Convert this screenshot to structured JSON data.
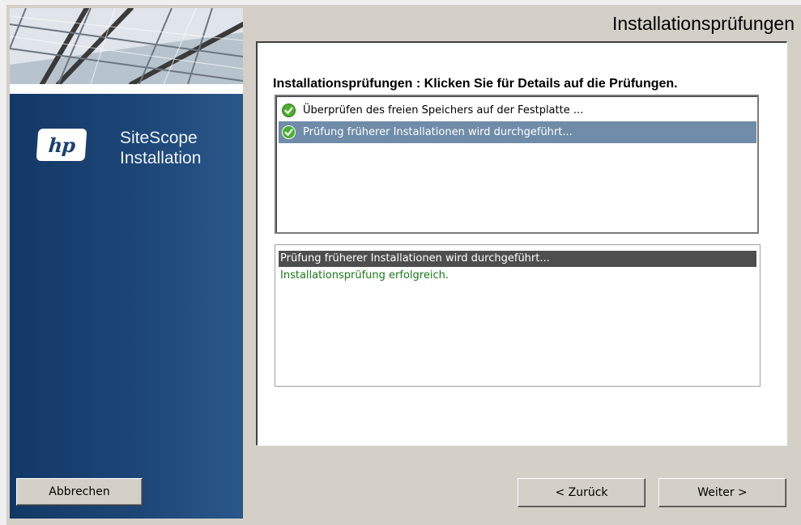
{
  "sidebar": {
    "brand_logo_text": "hp",
    "product_name_line1": "SiteScope",
    "product_name_line2": "Installation",
    "cancel_label": "Abbrechen"
  },
  "header": {
    "title": "Installationsprüfungen"
  },
  "checks": {
    "heading": "Installationsprüfungen : Klicken Sie für Details auf die Prüfungen.",
    "items": [
      {
        "label": "Überprüfen des freien Speichers auf der Festplatte ...",
        "status": "success",
        "selected": false
      },
      {
        "label": "Prüfung früherer Installationen wird durchgeführt...",
        "status": "success",
        "selected": true
      }
    ]
  },
  "details": {
    "title_line": "Prüfung früherer Installationen wird durchgeführt...",
    "result_line": "Installationsprüfung erfolgreich."
  },
  "navigation": {
    "back_label": "< Zurück",
    "next_label": "Weiter >"
  },
  "colors": {
    "sidebar_blue": "#1c4170",
    "selection": "#6f8ca8",
    "success_green": "#1a7a1a",
    "check_icon_green": "#4caf2e"
  }
}
